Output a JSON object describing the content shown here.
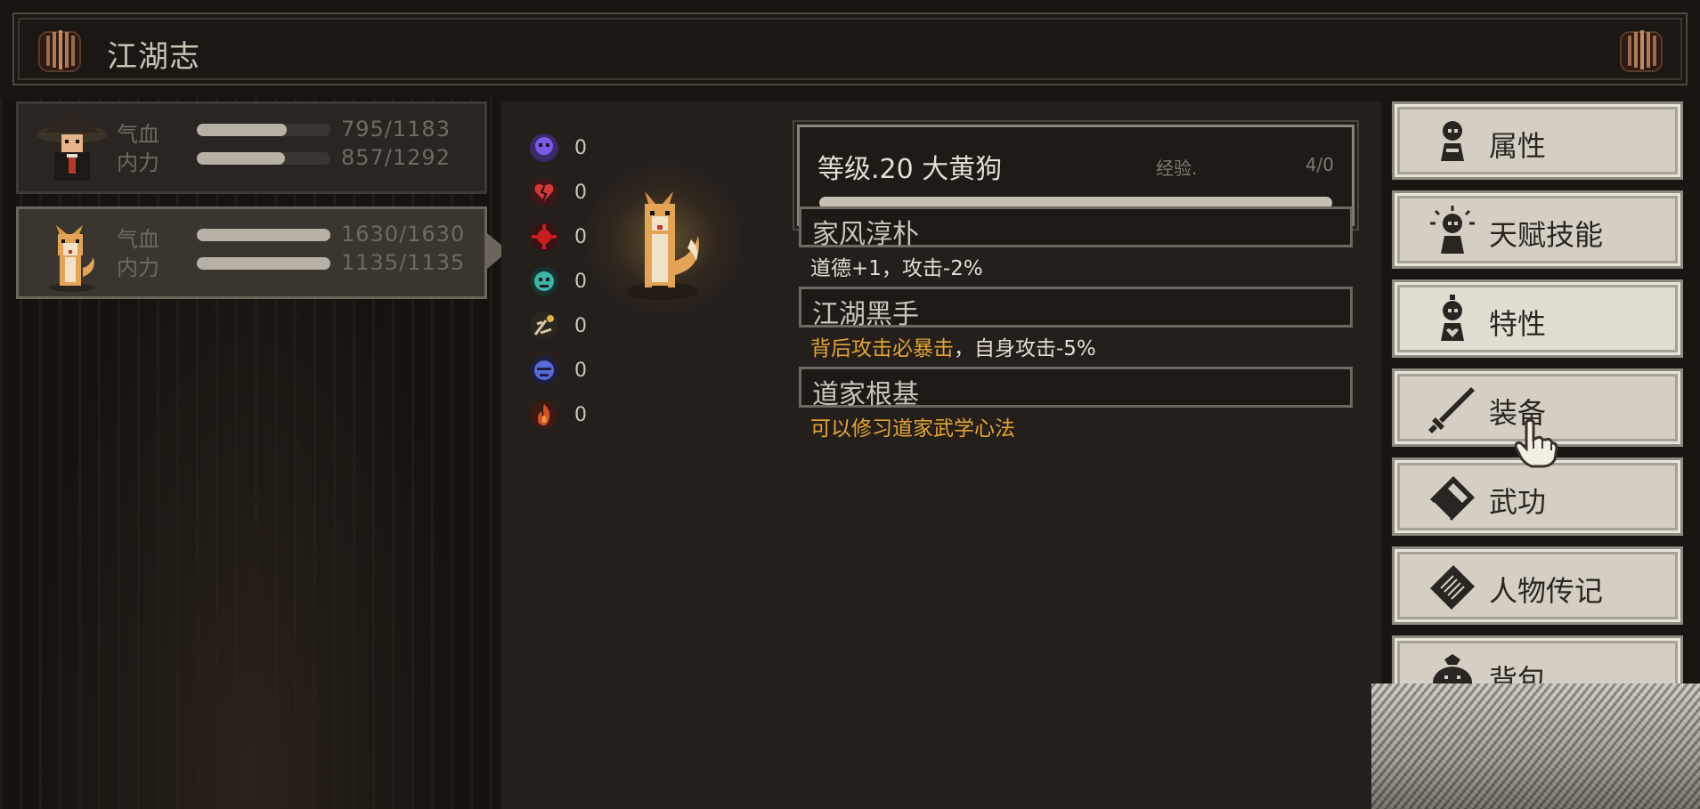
{
  "title": "江湖志",
  "party": [
    {
      "hp_label": "气血",
      "hp_value": "795/1183",
      "hp_fill": 0.67,
      "mp_label": "内力",
      "mp_value": "857/1292",
      "mp_fill": 0.66,
      "selected": false
    },
    {
      "hp_label": "气血",
      "hp_value": "1630/1630",
      "hp_fill": 1.0,
      "mp_label": "内力",
      "mp_value": "1135/1135",
      "mp_fill": 1.0,
      "selected": true
    }
  ],
  "resistances": [
    {
      "icon": "skull-icon",
      "color": "#6a4bd6",
      "value": "0"
    },
    {
      "icon": "broken-heart-icon",
      "color": "#d23a3a",
      "value": "0"
    },
    {
      "icon": "blood-splash-icon",
      "color": "#c41e1e",
      "value": "0"
    },
    {
      "icon": "poison-face-icon",
      "color": "#3fb3a6",
      "value": "0"
    },
    {
      "icon": "dizzy-icon",
      "color": "#d9c9a8",
      "value": "0"
    },
    {
      "icon": "frost-face-icon",
      "color": "#5b6ad9",
      "value": "0"
    },
    {
      "icon": "fire-icon",
      "color": "#d2512a",
      "value": "0"
    }
  ],
  "character": {
    "level_label": "等级.20  大黄狗",
    "exp_label": "经验.",
    "exp_value": "4/0",
    "exp_fill": 1.0
  },
  "traits": [
    {
      "name": "家风淳朴",
      "desc": "道德+1，攻击-2%"
    },
    {
      "name": "江湖黑手",
      "desc_gold": "背后攻击必暴击",
      "desc_rest": "，自身攻击-5%"
    },
    {
      "name": "道家根基",
      "desc_gold": "可以修习道家武学心法"
    }
  ],
  "menu": [
    {
      "label": "属性",
      "icon": "attribute-figure-icon"
    },
    {
      "label": "天赋技能",
      "icon": "talent-figure-icon"
    },
    {
      "label": "特性",
      "icon": "trait-figure-icon"
    },
    {
      "label": "装备",
      "icon": "sword-icon"
    },
    {
      "label": "武功",
      "icon": "martial-book-icon"
    },
    {
      "label": "人物传记",
      "icon": "biography-scroll-icon"
    },
    {
      "label": "背包",
      "icon": "backpack-icon"
    }
  ],
  "colors": {
    "gold": "#e0a43a",
    "menu_bg": "#d4cfc2",
    "panel_bg": "#251f1b"
  }
}
